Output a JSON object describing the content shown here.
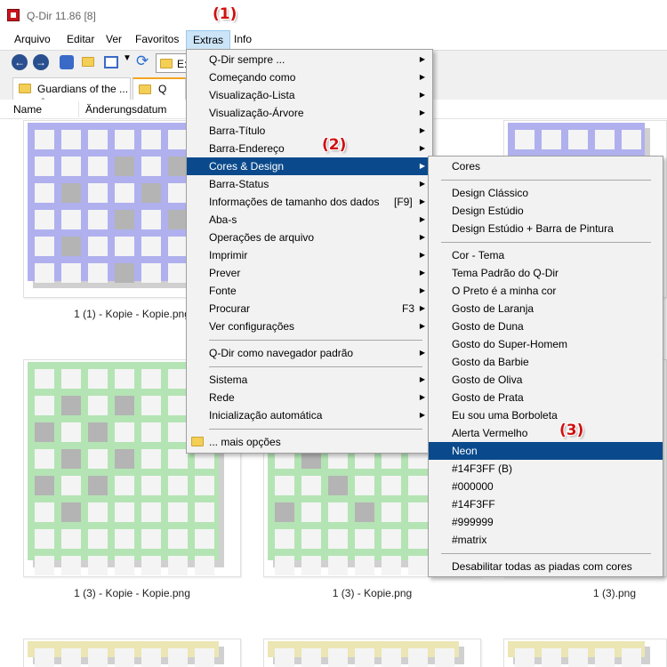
{
  "window": {
    "title": "Q-Dir 11.86 [8]"
  },
  "menubar": [
    "Arquivo",
    "Editar",
    "Ver",
    "Favoritos",
    "Extras",
    "Info"
  ],
  "toolbar": {
    "address_text": "E:"
  },
  "tabs": [
    "Guardians of the ...",
    "Q"
  ],
  "columns": [
    "Name",
    "Änderungsdatum"
  ],
  "files": [
    "1 (1) - Kopie - Kopie.png",
    "1 (3) - Kopie - Kopie.png",
    "1 (3) - Kopie.png",
    "1 (3).png"
  ],
  "callouts": [
    "(1)",
    "(2)",
    "(3)"
  ],
  "extras_menu": {
    "items": [
      {
        "label": "Q-Dir sempre ...",
        "submenu": true
      },
      {
        "label": "Começando como",
        "submenu": true
      },
      {
        "label": "Visualização-Lista",
        "submenu": true
      },
      {
        "label": "Visualização-Árvore",
        "submenu": true
      },
      {
        "label": "Barra-Título",
        "submenu": true
      },
      {
        "label": "Barra-Endereço",
        "submenu": true
      },
      {
        "label": "Cores & Design",
        "submenu": true,
        "highlighted": true
      },
      {
        "label": "Barra-Status",
        "submenu": true
      },
      {
        "label": "Informações de tamanho dos dados",
        "shortcut": "[F9]",
        "submenu": true
      },
      {
        "label": "Aba-s",
        "submenu": true
      },
      {
        "label": "Operações de arquivo",
        "submenu": true
      },
      {
        "label": "Imprimir",
        "submenu": true
      },
      {
        "label": "Prever",
        "submenu": true
      },
      {
        "label": "Fonte",
        "submenu": true
      },
      {
        "label": "Procurar",
        "shortcut": "F3",
        "submenu": true
      },
      {
        "label": "Ver configurações",
        "submenu": true
      },
      {
        "label": "Q-Dir como navegador padrão",
        "submenu": true
      },
      {
        "label": "Sistema",
        "submenu": true
      },
      {
        "label": "Rede",
        "submenu": true
      },
      {
        "label": "Inicialização automática",
        "submenu": true
      },
      {
        "label": "... mais opções",
        "submenu": false
      }
    ]
  },
  "colors_menu": {
    "items": [
      {
        "label": "Cores"
      },
      {
        "label": "Design Clássico"
      },
      {
        "label": "Design Estúdio"
      },
      {
        "label": "Design Estúdio + Barra de Pintura"
      },
      {
        "label": "Cor - Tema"
      },
      {
        "label": "Tema Padrão do Q-Dir"
      },
      {
        "label": "O Preto é a minha cor"
      },
      {
        "label": "Gosto de Laranja"
      },
      {
        "label": "Gosto de Duna"
      },
      {
        "label": "Gosto do Super-Homem"
      },
      {
        "label": "Gosto da Barbie"
      },
      {
        "label": "Gosto de Oliva"
      },
      {
        "label": "Gosto de Prata"
      },
      {
        "label": "Eu sou uma Borboleta"
      },
      {
        "label": "Alerta Vermelho"
      },
      {
        "label": "Neon",
        "highlighted": true
      },
      {
        "label": "#14F3FF (B)"
      },
      {
        "label": "#000000"
      },
      {
        "label": "#14F3FF"
      },
      {
        "label": "#999999"
      },
      {
        "label": "#matrix"
      },
      {
        "label": "Desabilitar todas as piadas com cores"
      }
    ]
  },
  "colors": {
    "highlight": "#0a4a8c",
    "callout": "#d01010",
    "thumb_purple": "#b0b0ee",
    "thumb_green": "#b4e4b4",
    "thumb_yellow": "#ebe6b4"
  }
}
